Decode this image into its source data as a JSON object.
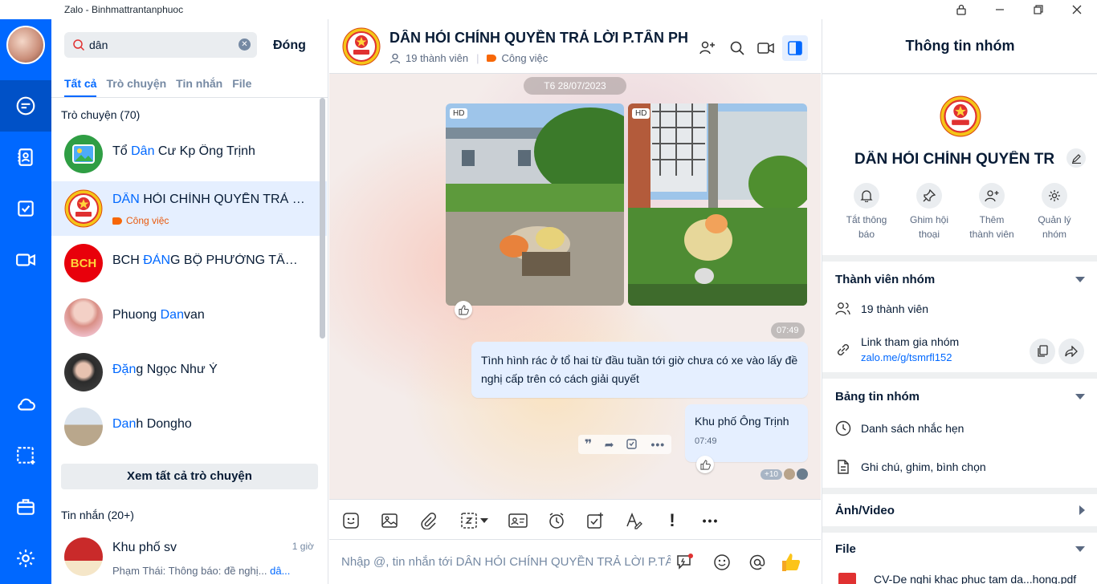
{
  "window": {
    "title": "Zalo - Binhmattrantanphuoc"
  },
  "search": {
    "value": "dân",
    "close_label": "Đóng"
  },
  "tabs": [
    "Tất cả",
    "Trò chuyện",
    "Tin nhắn",
    "File"
  ],
  "conversations_section": {
    "label": "Trò chuyện (70)",
    "items": [
      {
        "pre": "Tổ ",
        "hl": "Dân",
        "post": " Cư Kp Ông Trịnh"
      },
      {
        "pre": "",
        "hl": "DÂN",
        "post": " HỎI CHÍNH QUYỀN TRẢ L...",
        "tag": "Công việc"
      },
      {
        "pre": "BCH ",
        "hl": "ĐẢN",
        "post": "G BỘ PHƯỜNG TÂN ...",
        "avatar_text": "BCH"
      },
      {
        "pre": "Phuong ",
        "hl": "Dan",
        "post": "van"
      },
      {
        "pre": "",
        "hl": "Đặn",
        "post": "g Ngọc Như Ý"
      },
      {
        "pre": "",
        "hl": "Dan",
        "post": "h Dongho"
      }
    ],
    "see_all": "Xem tất cả trò chuyện"
  },
  "messages_section": {
    "label": "Tin nhắn (20+)",
    "items": [
      {
        "name": "Khu phố sv",
        "time": "1 giờ",
        "preview": "Phạm Thái: Thông báo: đề nghị... ",
        "preview_hl": "dâ..."
      }
    ]
  },
  "chat": {
    "group_name": "DÂN HỎI CHÍNH QUYỀN TRẢ LỜI P.TÂN PHU",
    "members": "19 thành viên",
    "tag": "Công việc",
    "date": "T6 28/07/2023",
    "photo_badge": "HD",
    "photo_time": "07:49",
    "message1": "Tình hình rác ở tổ hai từ đầu tuần tới giờ chưa có xe vào lấy đề nghị cấp trên có cách giải quyết",
    "message2": "Khu phố Ông Trịnh",
    "message2_time": "07:49",
    "seen_more": "+10",
    "composer_placeholder": "Nhập @, tin nhắn tới DÂN HỎI CHÍNH QUYỀN TRẢ LỜI P.TÂ..."
  },
  "info": {
    "header": "Thông tin nhóm",
    "group_name": "DÂN HỎI CHÍNH QUYỀN TR...",
    "actions": [
      {
        "l1": "Tắt thông",
        "l2": "báo",
        "icon": "bell-icon"
      },
      {
        "l1": "Ghim hội",
        "l2": "thoại",
        "icon": "pin-icon"
      },
      {
        "l1": "Thêm",
        "l2": "thành viên",
        "icon": "add-member-icon"
      },
      {
        "l1": "Quản lý",
        "l2": "nhóm",
        "icon": "gear-icon"
      }
    ],
    "members_title": "Thành viên nhóm",
    "members_count": "19 thành viên",
    "link_label": "Link tham gia nhóm",
    "link_value": "zalo.me/g/tsmrfl152",
    "board_title": "Bảng tin nhóm",
    "reminders": "Danh sách nhắc hẹn",
    "notes": "Ghi chú, ghim, bình chọn",
    "media_title": "Ảnh/Video",
    "file_title": "File",
    "file_item": "CV-De nghi khac phuc tam da...hong.pdf"
  },
  "colors": {
    "brand": "#0068ff",
    "nav_active": "#0051c7",
    "tag": "#f76707"
  }
}
